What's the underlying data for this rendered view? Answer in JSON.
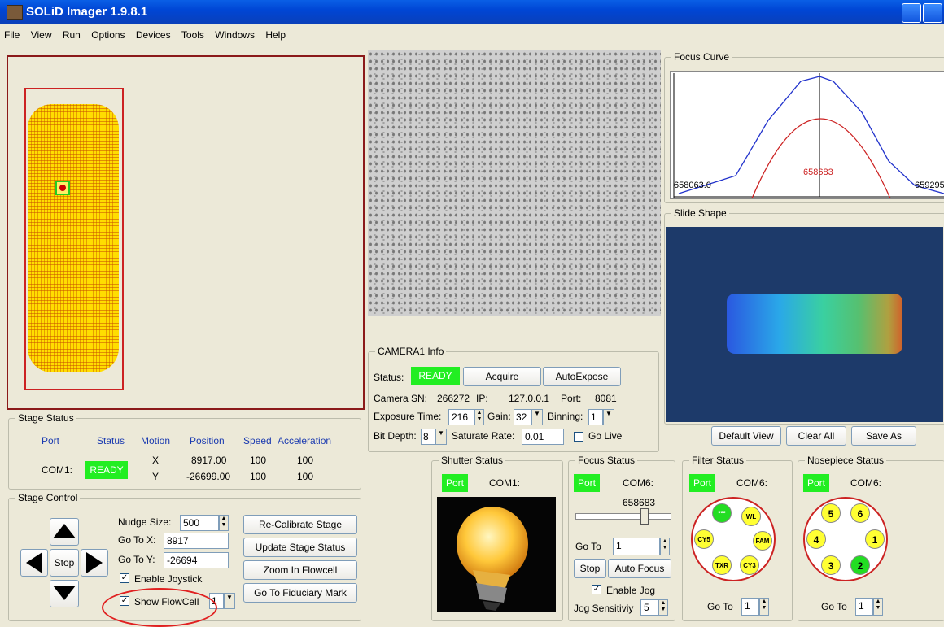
{
  "window": {
    "title": "SOLiD Imager 1.9.8.1"
  },
  "menu": [
    "File",
    "View",
    "Run",
    "Options",
    "Devices",
    "Tools",
    "Windows",
    "Help"
  ],
  "stage_status": {
    "title": "Stage Status",
    "headers": {
      "port": "Port",
      "status": "Status",
      "motion": "Motion",
      "position": "Position",
      "speed": "Speed",
      "acceleration": "Acceleration"
    },
    "port": "COM1:",
    "status": "READY",
    "rows": [
      {
        "axis": "X",
        "position": "8917.00",
        "speed": "100",
        "acceleration": "100"
      },
      {
        "axis": "Y",
        "position": "-26699.00",
        "speed": "100",
        "acceleration": "100"
      }
    ]
  },
  "stage_control": {
    "title": "Stage Control",
    "stop_label": "Stop",
    "nudge_label": "Nudge Size:",
    "nudge_value": "500",
    "gotox_label": "Go To X:",
    "gotox_value": "8917",
    "gotoy_label": "Go To Y:",
    "gotoy_value": "-26694",
    "enable_joystick": "Enable Joystick",
    "show_flowcell": "Show FlowCell",
    "flowcell_num": "1",
    "buttons": {
      "recalibrate": "Re-Calibrate Stage",
      "update": "Update Stage Status",
      "zoom": "Zoom In Flowcell",
      "fiduciary": "Go To Fiduciary Mark"
    }
  },
  "camera": {
    "title": "CAMERA1 Info",
    "status_label": "Status:",
    "status": "READY",
    "acquire": "Acquire",
    "autoexpose": "AutoExpose",
    "sn_label": "Camera SN:",
    "sn": "266272",
    "ip_label": "IP:",
    "ip": "127.0.0.1",
    "port_label": "Port:",
    "port": "8081",
    "exposure_label": "Exposure Time:",
    "exposure": "216",
    "gain_label": "Gain:",
    "gain": "32",
    "binning_label": "Binning:",
    "binning": "1",
    "bitdepth_label": "Bit Depth:",
    "bitdepth": "8",
    "saturate_label": "Saturate Rate:",
    "saturate": "0.01",
    "golive": "Go Live"
  },
  "focus_curve": {
    "title": "Focus Curve",
    "left": "658063.0",
    "center": "658683",
    "right": "659295"
  },
  "slide_shape": {
    "title": "Slide Shape",
    "buttons": {
      "default": "Default View",
      "clear": "Clear All",
      "save": "Save As"
    }
  },
  "shutter": {
    "title": "Shutter Status",
    "port": "Port",
    "com": "COM1:"
  },
  "focus_status": {
    "title": "Focus Status",
    "port": "Port",
    "com": "COM6:",
    "value": "658683",
    "slider_fraction": 0.83,
    "goto_label": "Go To",
    "goto_value": "1",
    "stop": "Stop",
    "autofocus": "Auto Focus",
    "enable_jog": "Enable Jog",
    "jog_label": "Jog Sensitiviy",
    "jog_value": "5"
  },
  "filter_status": {
    "title": "Filter Status",
    "port": "Port",
    "com": "COM6:",
    "goto_label": "Go To",
    "goto_value": "1",
    "positions": [
      "***",
      "WL",
      "FAM",
      "CY3",
      "TXR",
      "CY5"
    ]
  },
  "nosepiece_status": {
    "title": "Nosepiece Status",
    "port": "Port",
    "com": "COM6:",
    "goto_label": "Go To",
    "goto_value": "1",
    "positions": [
      "6",
      "1",
      "2",
      "3",
      "4",
      "5"
    ]
  },
  "colors": {
    "ready": "#22ee22",
    "accent_red": "#cc2222",
    "flowcell_yellow": "#ffee00",
    "slide_bg": "#1d3a6a"
  }
}
